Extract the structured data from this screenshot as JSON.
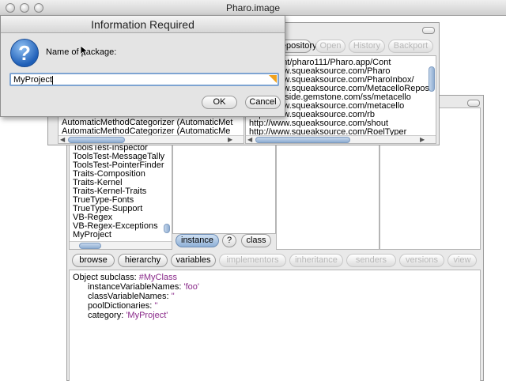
{
  "world": {
    "title": "Pharo.image"
  },
  "dialog": {
    "title": "Information Required",
    "prompt": "Name of package:",
    "value": "MyProject",
    "ok_label": "OK",
    "cancel_label": "Cancel"
  },
  "monticello": {
    "tabs": [
      "Repository",
      "Open",
      "History",
      "Backport"
    ],
    "packages": [
      "AutomaticMethodCategorizer (AutomaticMet",
      "AutomaticMethodCategorizer (AutomaticMe"
    ],
    "repositories": [
      "FreeAgent/pharo111/Pharo.app/Cont",
      "http://www.squeaksource.com/Pharo",
      "http://www.squeaksource.com/PharoInbox/",
      "http://www.squeaksource.com/MetacelloRepos",
      "http://seaside.gemstone.com/ss/metacello",
      "http://www.squeaksource.com/metacello",
      "http://www.squeaksource.com/rb",
      "http://www.squeaksource.com/shout",
      "http://www.squeaksource.com/RoelTyper"
    ]
  },
  "browser": {
    "categories": [
      "ToolsTest-Inspector",
      "ToolsTest-MessageTally",
      "ToolsTest-PointerFinder",
      "Traits-Composition",
      "Traits-Kernel",
      "Traits-Kernel-Traits",
      "TrueType-Fonts",
      "TrueType-Support",
      "VB-Regex",
      "VB-Regex-Exceptions",
      "MyProject"
    ],
    "instance_label": "instance",
    "help_label": "?",
    "class_label": "class",
    "toolbar": [
      "browse",
      "hierarchy",
      "variables",
      "implementors",
      "inheritance",
      "senders",
      "versions",
      "view"
    ],
    "code": {
      "line1_prefix": "Object subclass: ",
      "line1_symbol": "#MyClass",
      "line2_prefix": "instanceVariableNames: ",
      "line2_value": "'foo'",
      "line3_prefix": "classVariableNames: ",
      "line3_value": "''",
      "line4_prefix": "poolDictionaries: ",
      "line4_value": "''",
      "line5_prefix": "category: ",
      "line5_value": "'MyProject'"
    }
  }
}
